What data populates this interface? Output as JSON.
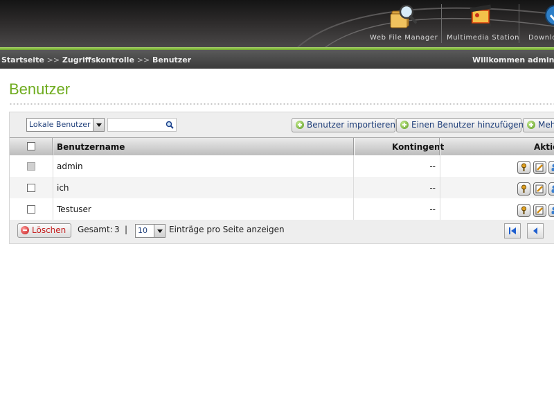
{
  "header": {
    "apps": [
      {
        "label": "Web File Manager",
        "icon": "magnifier-folder-icon"
      },
      {
        "label": "Multimedia Station",
        "icon": "multimedia-icon"
      },
      {
        "label": "Downlo",
        "icon": "download-icon"
      }
    ]
  },
  "breadcrumb": {
    "items": [
      "Startseite",
      "Zugriffskontrolle",
      "Benutzer"
    ],
    "separator": ">>",
    "welcome": "Willkommen admin |"
  },
  "page": {
    "title": "Benutzer"
  },
  "toolbar": {
    "user_scope": "Lokale Benutzer",
    "search_placeholder": "",
    "import_label": "Benutzer importieren",
    "add_label": "Einen Benutzer hinzufügen",
    "more_label": "Meh"
  },
  "table": {
    "headers": {
      "username": "Benutzername",
      "quota": "Kontingent",
      "actions": "Aktio"
    },
    "rows": [
      {
        "username": "admin",
        "quota": "--",
        "checkbox_disabled": true
      },
      {
        "username": "ich",
        "quota": "--",
        "checkbox_disabled": false
      },
      {
        "username": "Testuser",
        "quota": "--",
        "checkbox_disabled": false
      }
    ]
  },
  "footer": {
    "delete_label": "Löschen",
    "total_label": "Gesamt:",
    "total_count": "3",
    "divider": "|",
    "per_page": "10",
    "per_page_label": "Einträge pro Seite anzeigen"
  },
  "colors": {
    "accent_green": "#6fac1f",
    "link_blue": "#1f3f7a",
    "delete_red": "#c41e1e"
  }
}
